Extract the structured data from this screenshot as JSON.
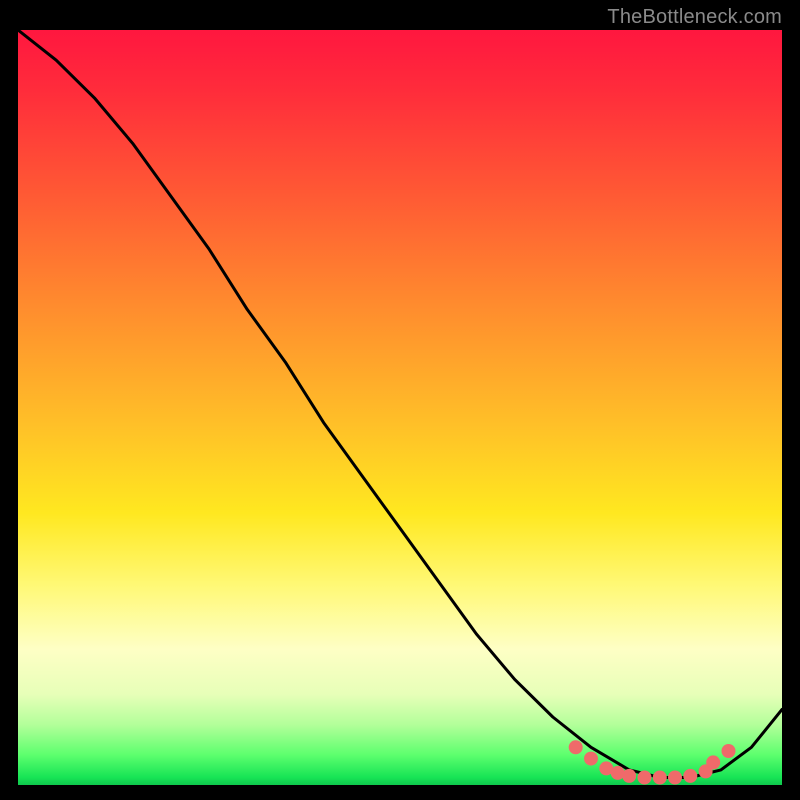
{
  "watermark": "TheBottleneck.com",
  "chart_data": {
    "type": "line",
    "title": "",
    "xlabel": "",
    "ylabel": "",
    "xlim": [
      0,
      100
    ],
    "ylim": [
      0,
      100
    ],
    "series": [
      {
        "name": "curve",
        "x": [
          0,
          5,
          10,
          15,
          20,
          25,
          30,
          35,
          40,
          45,
          50,
          55,
          60,
          65,
          70,
          75,
          80,
          84,
          88,
          92,
          96,
          100
        ],
        "y": [
          100,
          96,
          91,
          85,
          78,
          71,
          63,
          56,
          48,
          41,
          34,
          27,
          20,
          14,
          9,
          5,
          2,
          1,
          1,
          2,
          5,
          10
        ]
      }
    ],
    "markers": {
      "name": "dots",
      "color": "#ef6a6a",
      "x": [
        73,
        75,
        77,
        78.5,
        80,
        82,
        84,
        86,
        88,
        90,
        91,
        93
      ],
      "y": [
        5,
        3.5,
        2.2,
        1.6,
        1.2,
        1.0,
        1.0,
        1.0,
        1.2,
        1.8,
        3.0,
        4.5
      ]
    }
  }
}
